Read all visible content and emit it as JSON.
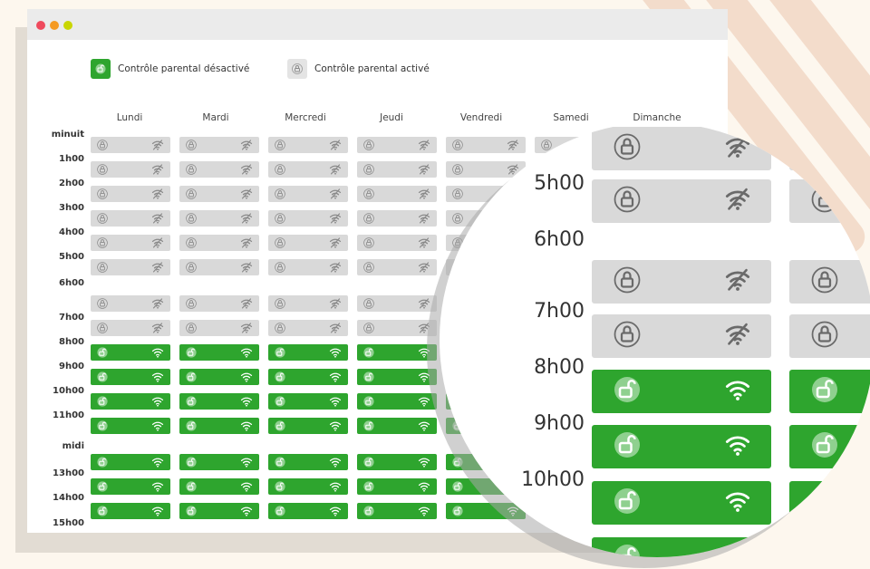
{
  "legend": {
    "disabled_label": "Contrôle parental désactivé",
    "enabled_label": "Contrôle parental activé"
  },
  "days": [
    "Lundi",
    "Mardi",
    "Mercredi",
    "Jeudi",
    "Vendredi",
    "Samedi",
    "Dimanche"
  ],
  "hours": [
    "minuit",
    "1h00",
    "2h00",
    "3h00",
    "4h00",
    "5h00",
    "6h00",
    "7h00",
    "8h00",
    "9h00",
    "10h00",
    "11h00",
    "midi",
    "13h00",
    "14h00",
    "15h00"
  ],
  "schedule_rows": [
    {
      "state": "activé"
    },
    {
      "state": "activé"
    },
    {
      "state": "activé"
    },
    {
      "state": "activé"
    },
    {
      "state": "activé"
    },
    {
      "state": "activé"
    },
    {
      "state": "activé"
    },
    {
      "state": "activé"
    },
    {
      "state": "désactivé"
    },
    {
      "state": "désactivé"
    },
    {
      "state": "désactivé"
    },
    {
      "state": "désactivé"
    },
    {
      "state": "désactivé"
    },
    {
      "state": "désactivé"
    },
    {
      "state": "désactivé"
    }
  ],
  "magnifier": {
    "hours": [
      "5h00",
      "6h00",
      "7h00",
      "8h00",
      "9h00",
      "10h00"
    ]
  },
  "colors": {
    "enabled_cell": "#d9d9d9",
    "disabled_cell": "#2ea52e",
    "window_dots": [
      "#ef4a5d",
      "#f59a23",
      "#c9d600"
    ]
  },
  "icons": {
    "enabled": [
      "lock-closed-icon",
      "wifi-off-icon"
    ],
    "disabled": [
      "lock-open-icon",
      "wifi-icon"
    ]
  }
}
